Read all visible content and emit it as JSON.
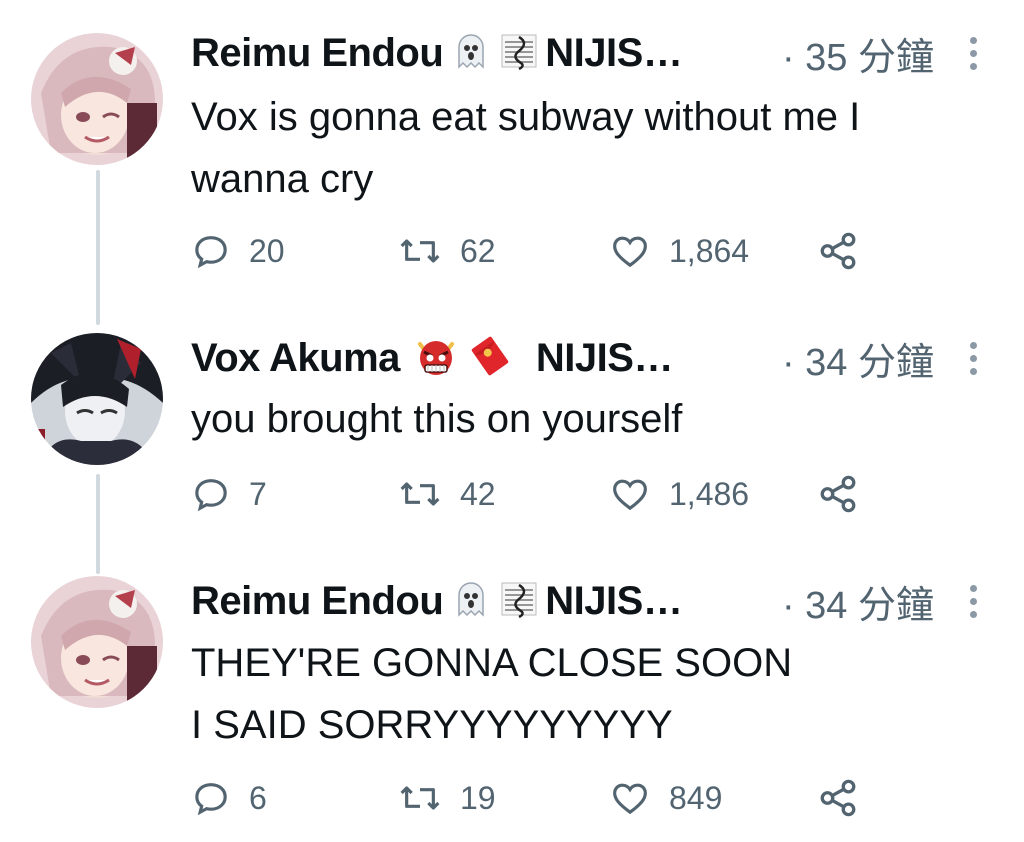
{
  "tweets": [
    {
      "author": "Reimu Endou",
      "suffix": "NIJIS…",
      "time": "· 35 分鐘",
      "text": "Vox is gonna eat subway without me I\nwanna cry",
      "replies": "20",
      "retweets": "62",
      "likes": "1,864",
      "emojis": [
        "ghost-icon",
        "musical-score-icon"
      ]
    },
    {
      "author": "Vox Akuma",
      "suffix": "NIJIS…",
      "time": "· 34 分鐘",
      "text": "you brought this on yourself",
      "replies": "7",
      "retweets": "42",
      "likes": "1,486",
      "emojis": [
        "ogre-icon",
        "red-envelope-icon"
      ]
    },
    {
      "author": "Reimu Endou",
      "suffix": "NIJIS…",
      "time": "· 34 分鐘",
      "text": "THEY'RE GONNA CLOSE SOON\nI SAID SORRYYYYYYYYY",
      "replies": "6",
      "retweets": "19",
      "likes": "849",
      "emojis": [
        "ghost-icon",
        "musical-score-icon"
      ]
    }
  ],
  "colors": {
    "text": "#0f1419",
    "muted": "#536471",
    "thread": "#cfd9de"
  }
}
